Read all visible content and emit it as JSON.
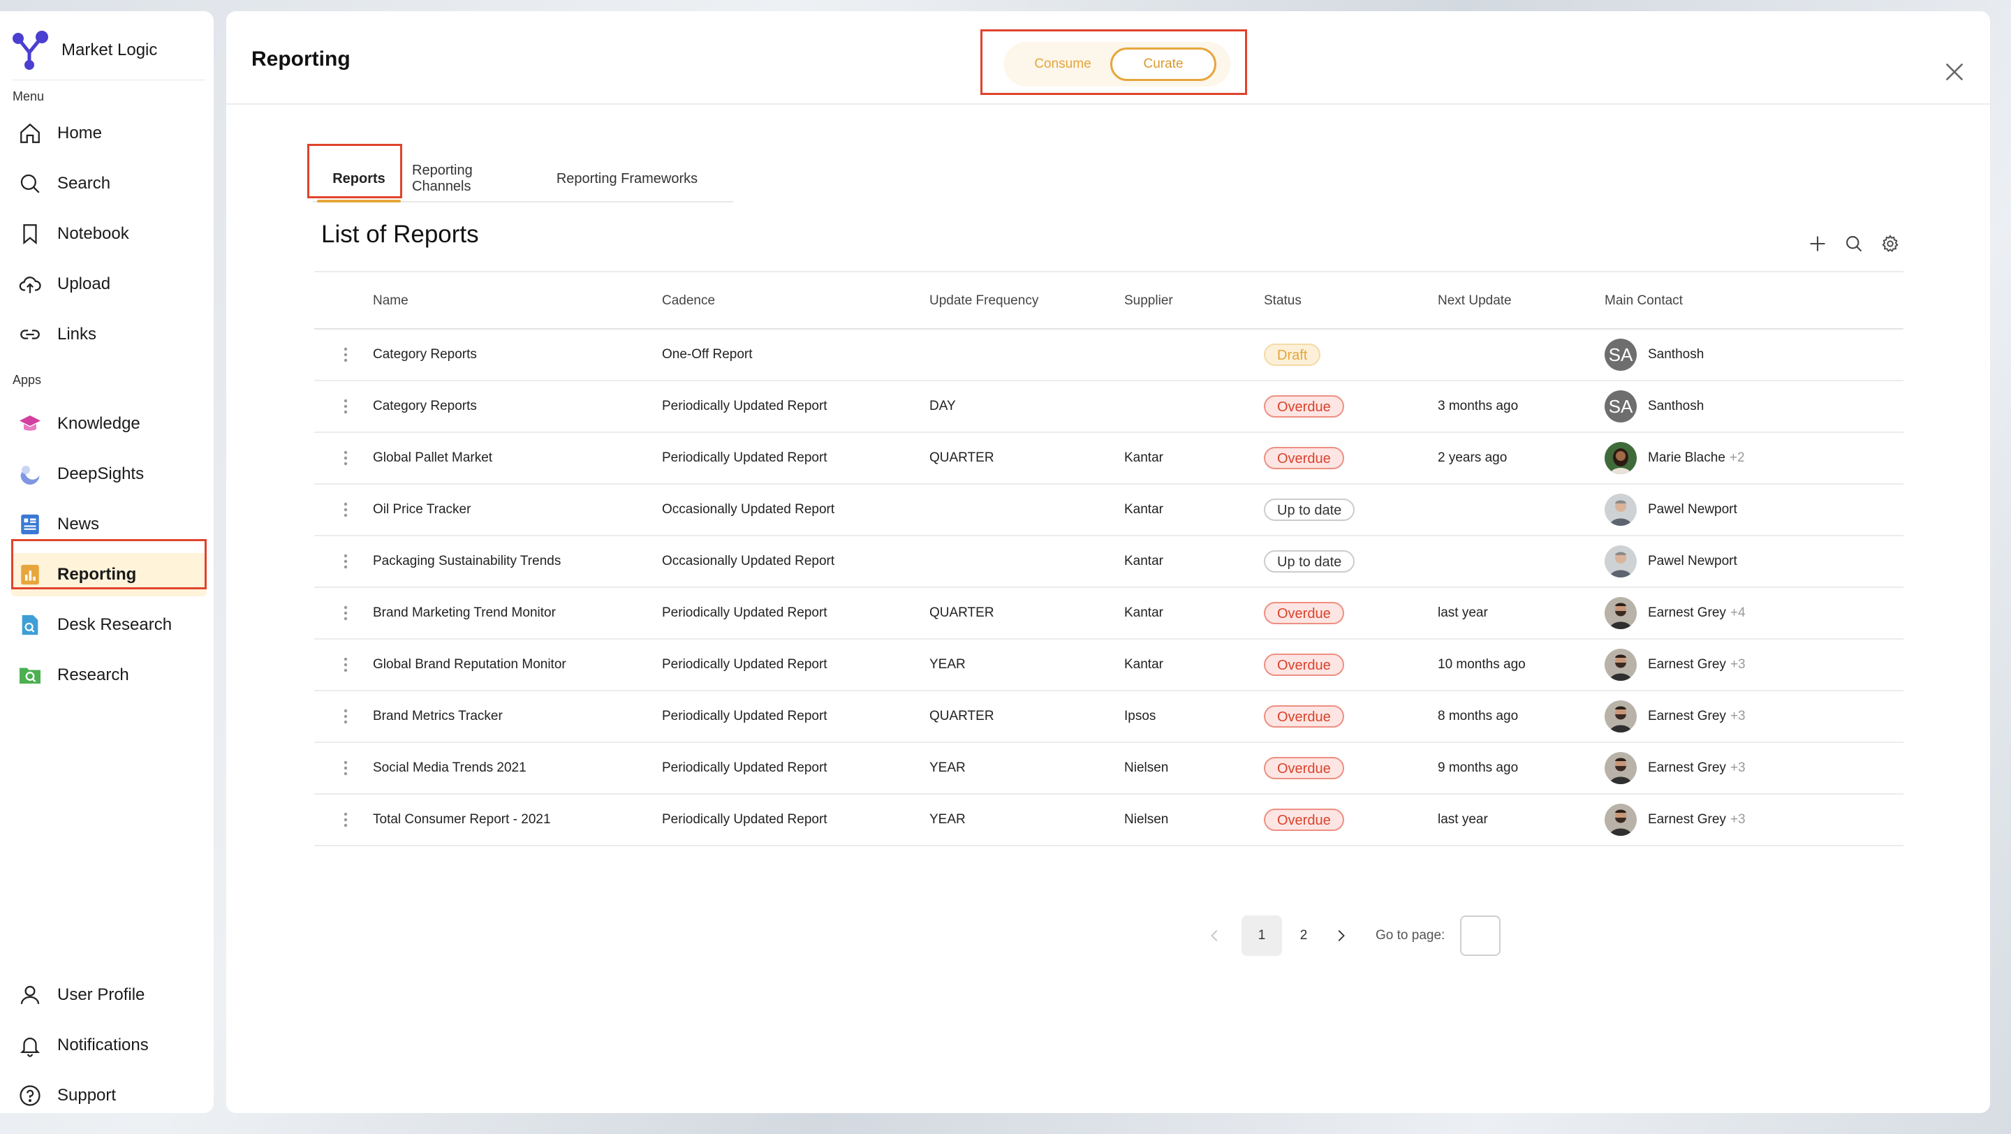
{
  "brand": {
    "name": "Market Logic",
    "logo_icon": "market-logic-logo-icon"
  },
  "sidebar": {
    "menu_label": "Menu",
    "apps_label": "Apps",
    "menu_items": [
      {
        "label": "Home",
        "icon": "home-icon"
      },
      {
        "label": "Search",
        "icon": "search-icon"
      },
      {
        "label": "Notebook",
        "icon": "bookmark-icon"
      },
      {
        "label": "Upload",
        "icon": "cloud-upload-icon"
      },
      {
        "label": "Links",
        "icon": "link-icon"
      }
    ],
    "app_items": [
      {
        "label": "Knowledge",
        "icon": "knowledge-icon",
        "color": "#d23fa0"
      },
      {
        "label": "DeepSights",
        "icon": "deepsights-icon",
        "color": "#5b7fd6"
      },
      {
        "label": "News",
        "icon": "news-icon",
        "color": "#3a78d4"
      },
      {
        "label": "Reporting",
        "icon": "reporting-icon",
        "color": "#e6a63c",
        "active": true
      },
      {
        "label": "Desk Research",
        "icon": "desk-research-icon",
        "color": "#3d9fd6"
      },
      {
        "label": "Research",
        "icon": "research-icon",
        "color": "#4caf50"
      }
    ],
    "bottom_items": [
      {
        "label": "User Profile",
        "icon": "user-icon"
      },
      {
        "label": "Notifications",
        "icon": "bell-icon"
      },
      {
        "label": "Support",
        "icon": "help-circle-icon"
      }
    ]
  },
  "header": {
    "title": "Reporting",
    "mode_toggle": {
      "left": "Consume",
      "right": "Curate",
      "selected": "Curate"
    },
    "close_icon": "close-icon"
  },
  "tabs": [
    {
      "label": "Reports",
      "active": true
    },
    {
      "label": "Reporting Channels"
    },
    {
      "label": "Reporting Frameworks"
    }
  ],
  "list": {
    "title": "List of Reports",
    "actions": [
      "plus-icon",
      "search-icon",
      "gear-icon"
    ],
    "columns": [
      "Name",
      "Cadence",
      "Update Frequency",
      "Supplier",
      "Status",
      "Next Update",
      "Main Contact"
    ],
    "rows": [
      {
        "name": "Category Reports",
        "cadence": "One-Off Report",
        "frequency": "",
        "supplier": "",
        "status": "Draft",
        "status_type": "draft",
        "next_update": "",
        "contact": "Santhosh",
        "contact_extra": "",
        "avatar": "SA"
      },
      {
        "name": "Category Reports",
        "cadence": "Periodically Updated Report",
        "frequency": "DAY",
        "supplier": "",
        "status": "Overdue",
        "status_type": "overdue",
        "next_update": "3 months ago",
        "contact": "Santhosh",
        "contact_extra": "",
        "avatar": "SA"
      },
      {
        "name": "Global Pallet Market",
        "cadence": "Periodically Updated Report",
        "frequency": "QUARTER",
        "supplier": "Kantar",
        "status": "Overdue",
        "status_type": "overdue",
        "next_update": "2 years ago",
        "contact": "Marie Blache",
        "contact_extra": "+2",
        "avatar": "photo-woman"
      },
      {
        "name": "Oil Price Tracker",
        "cadence": "Occasionally Updated Report",
        "frequency": "",
        "supplier": "Kantar",
        "status": "Up to date",
        "status_type": "uptodate",
        "next_update": "",
        "contact": "Pawel Newport",
        "contact_extra": "",
        "avatar": "photo-man-gray"
      },
      {
        "name": "Packaging Sustainability Trends",
        "cadence": "Occasionally Updated Report",
        "frequency": "",
        "supplier": "Kantar",
        "status": "Up to date",
        "status_type": "uptodate",
        "next_update": "",
        "contact": "Pawel Newport",
        "contact_extra": "",
        "avatar": "photo-man-gray"
      },
      {
        "name": "Brand Marketing Trend Monitor",
        "cadence": "Periodically Updated Report",
        "frequency": "QUARTER",
        "supplier": "Kantar",
        "status": "Overdue",
        "status_type": "overdue",
        "next_update": "last year",
        "contact": "Earnest Grey",
        "contact_extra": "+4",
        "avatar": "photo-man-beard"
      },
      {
        "name": "Global Brand Reputation Monitor",
        "cadence": "Periodically Updated Report",
        "frequency": "YEAR",
        "supplier": "Kantar",
        "status": "Overdue",
        "status_type": "overdue",
        "next_update": "10 months ago",
        "contact": "Earnest Grey",
        "contact_extra": "+3",
        "avatar": "photo-man-beard"
      },
      {
        "name": "Brand Metrics Tracker",
        "cadence": "Periodically Updated Report",
        "frequency": "QUARTER",
        "supplier": "Ipsos",
        "status": "Overdue",
        "status_type": "overdue",
        "next_update": "8 months ago",
        "contact": "Earnest Grey",
        "contact_extra": "+3",
        "avatar": "photo-man-beard"
      },
      {
        "name": "Social Media Trends 2021",
        "cadence": "Periodically Updated Report",
        "frequency": "YEAR",
        "supplier": "Nielsen",
        "status": "Overdue",
        "status_type": "overdue",
        "next_update": "9 months ago",
        "contact": "Earnest Grey",
        "contact_extra": "+3",
        "avatar": "photo-man-beard"
      },
      {
        "name": "Total Consumer Report - 2021",
        "cadence": "Periodically Updated Report",
        "frequency": "YEAR",
        "supplier": "Nielsen",
        "status": "Overdue",
        "status_type": "overdue",
        "next_update": "last year",
        "contact": "Earnest Grey",
        "contact_extra": "+3",
        "avatar": "photo-man-beard"
      }
    ]
  },
  "pagination": {
    "pages": [
      "1",
      "2"
    ],
    "current": "1",
    "goto_label": "Go to page:",
    "goto_value": ""
  },
  "colors": {
    "accent": "#e6a63c",
    "overdue": "#d9432c",
    "highlight": "#e0432c"
  }
}
